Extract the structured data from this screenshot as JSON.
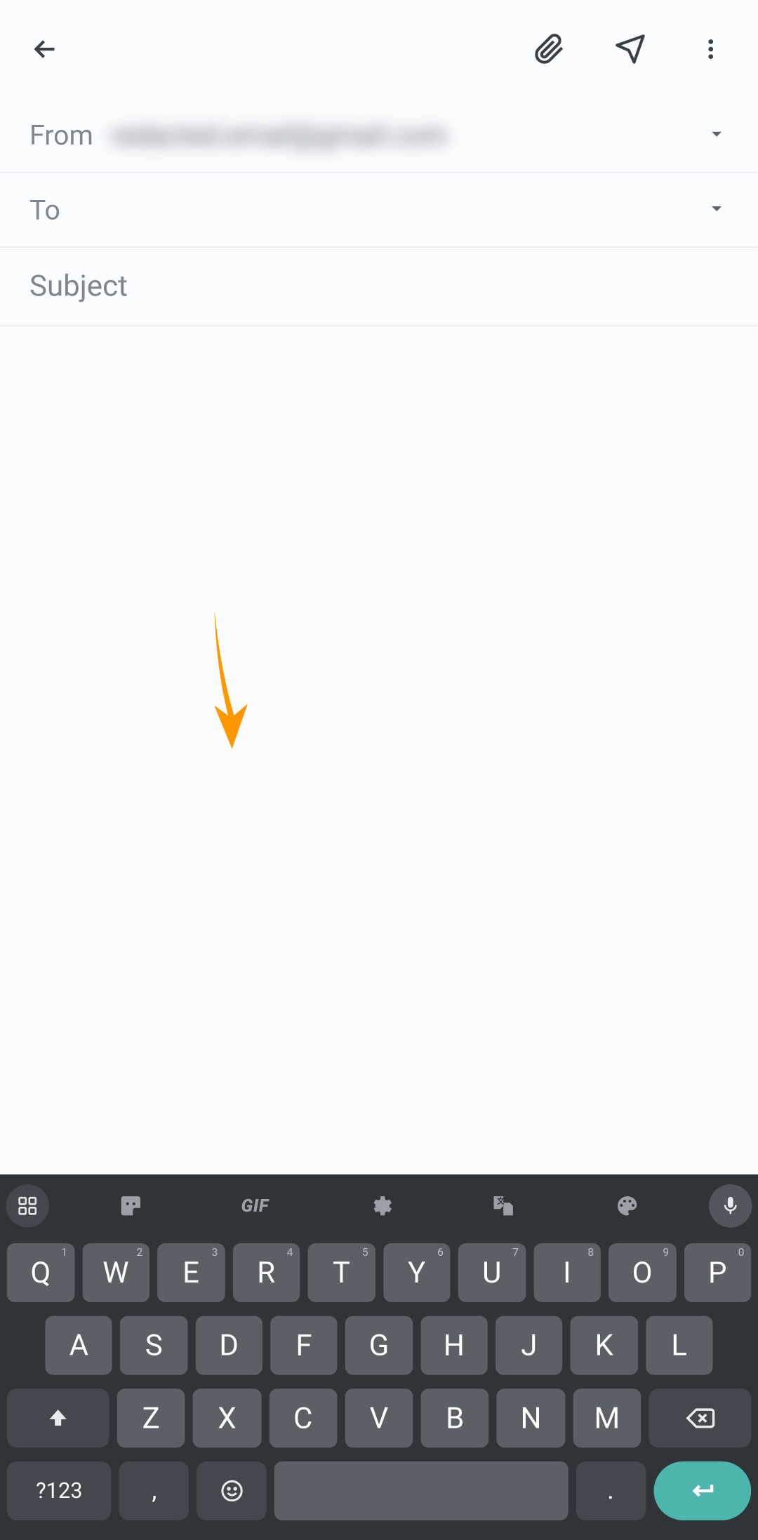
{
  "compose": {
    "from_label": "From",
    "from_value": "redacted.email@gmail.com",
    "to_label": "To",
    "subject_placeholder": "Subject"
  },
  "keyboard": {
    "gif_label": "GIF",
    "row1": [
      {
        "letter": "Q",
        "num": "1"
      },
      {
        "letter": "W",
        "num": "2"
      },
      {
        "letter": "E",
        "num": "3"
      },
      {
        "letter": "R",
        "num": "4"
      },
      {
        "letter": "T",
        "num": "5"
      },
      {
        "letter": "Y",
        "num": "6"
      },
      {
        "letter": "U",
        "num": "7"
      },
      {
        "letter": "I",
        "num": "8"
      },
      {
        "letter": "O",
        "num": "9"
      },
      {
        "letter": "P",
        "num": "0"
      }
    ],
    "row2": [
      "A",
      "S",
      "D",
      "F",
      "G",
      "H",
      "J",
      "K",
      "L"
    ],
    "row3": [
      "Z",
      "X",
      "C",
      "V",
      "B",
      "N",
      "M"
    ],
    "symbols_key": "?123",
    "comma_key": ",",
    "period_key": "."
  }
}
